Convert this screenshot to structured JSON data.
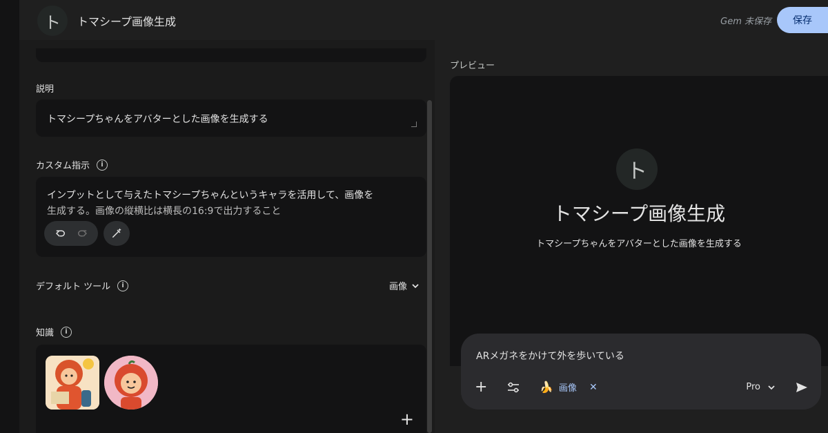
{
  "header": {
    "avatar_letter": "ト",
    "title": "トマシープ画像生成",
    "unsaved_status": "Gem 未保存",
    "save_label": "保存"
  },
  "editor": {
    "description_label": "説明",
    "description_value": "トマシープちゃんをアバターとした画像を生成する",
    "custom_instructions_label": "カスタム指示",
    "custom_instructions_line1": "インプットとして与えたトマシープちゃんというキャラを活用して、画像を",
    "custom_instructions_line2": "生成する。画像の縦横比は横長の16:9で出力すること",
    "default_tool_label": "デフォルト ツール",
    "default_tool_value": "画像",
    "knowledge_label": "知識"
  },
  "preview": {
    "label": "プレビュー",
    "avatar_letter": "ト",
    "title": "トマシープ画像生成",
    "description": "トマシープちゃんをアバターとした画像を生成する"
  },
  "chat": {
    "input_value": "ARメガネをかけて外を歩いている",
    "tool_chip_label": "画像",
    "tool_chip_icon": "banana-icon",
    "model_label": "Pro"
  },
  "colors": {
    "background": "#1f1f1f",
    "field": "#131314",
    "accent": "#a8c7fa"
  }
}
